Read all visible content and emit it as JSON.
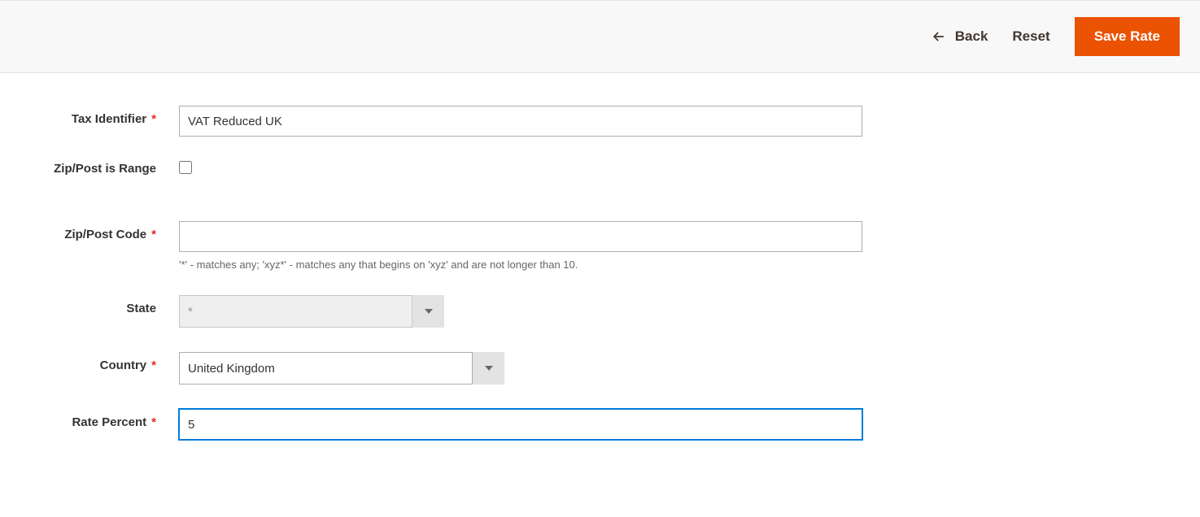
{
  "toolbar": {
    "back_label": "Back",
    "reset_label": "Reset",
    "save_label": "Save Rate"
  },
  "form": {
    "tax_identifier": {
      "label": "Tax Identifier",
      "value": "VAT Reduced UK",
      "required": true
    },
    "zip_is_range": {
      "label": "Zip/Post is Range",
      "checked": false
    },
    "zip_code": {
      "label": "Zip/Post Code",
      "value": "",
      "required": true,
      "help": "'*' - matches any; 'xyz*' - matches any that begins on 'xyz' and are not longer than 10."
    },
    "state": {
      "label": "State",
      "value": "*",
      "disabled": true
    },
    "country": {
      "label": "Country",
      "value": "United Kingdom",
      "required": true
    },
    "rate_percent": {
      "label": "Rate Percent",
      "value": "5",
      "required": true
    }
  }
}
